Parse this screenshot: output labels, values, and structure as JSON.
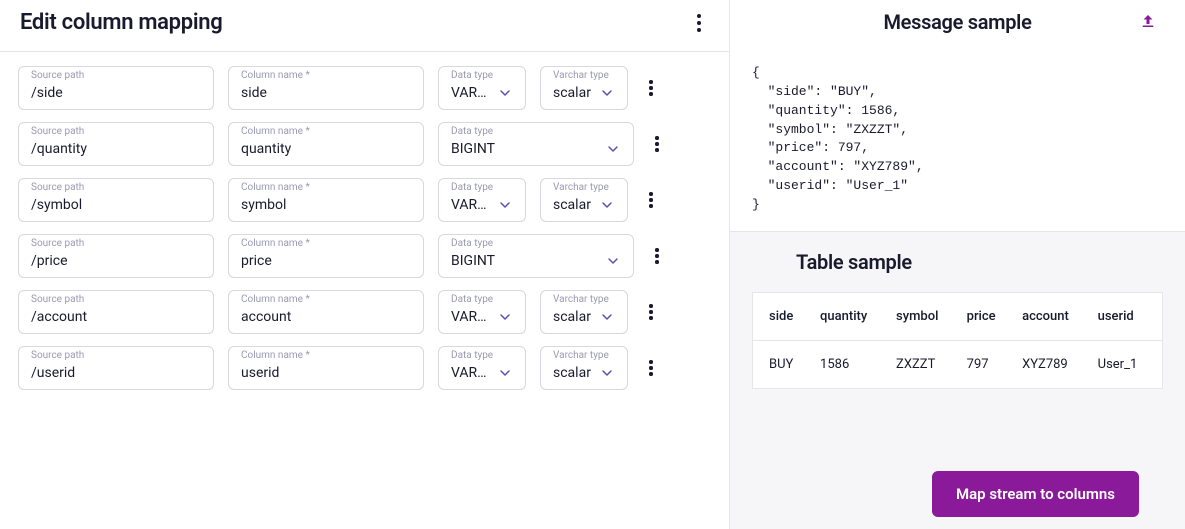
{
  "left": {
    "title": "Edit column mapping",
    "labels": {
      "source_path": "Source path",
      "column_name": "Column name *",
      "data_type": "Data type",
      "varchar_type": "Varchar type"
    },
    "rows": [
      {
        "source_path": "/side",
        "column_name": "side",
        "data_type": "VARC...",
        "data_type_wide": false,
        "varchar_type": "scalar"
      },
      {
        "source_path": "/quantity",
        "column_name": "quantity",
        "data_type": "BIGINT",
        "data_type_wide": true,
        "varchar_type": null
      },
      {
        "source_path": "/symbol",
        "column_name": "symbol",
        "data_type": "VARC...",
        "data_type_wide": false,
        "varchar_type": "scalar"
      },
      {
        "source_path": "/price",
        "column_name": "price",
        "data_type": "BIGINT",
        "data_type_wide": true,
        "varchar_type": null
      },
      {
        "source_path": "/account",
        "column_name": "account",
        "data_type": "VARC...",
        "data_type_wide": false,
        "varchar_type": "scalar"
      },
      {
        "source_path": "/userid",
        "column_name": "userid",
        "data_type": "VARC...",
        "data_type_wide": false,
        "varchar_type": "scalar"
      }
    ]
  },
  "right": {
    "message_sample_title": "Message sample",
    "json_lines": [
      "{",
      "  \"side\": \"BUY\",",
      "  \"quantity\": 1586,",
      "  \"symbol\": \"ZXZZT\",",
      "  \"price\": 797,",
      "  \"account\": \"XYZ789\",",
      "  \"userid\": \"User_1\"",
      "}"
    ],
    "table_sample_title": "Table sample",
    "table": {
      "headers": [
        "side",
        "quantity",
        "symbol",
        "price",
        "account",
        "userid"
      ],
      "row": [
        "BUY",
        "1586",
        "ZXZZT",
        "797",
        "XYZ789",
        "User_1"
      ]
    }
  },
  "cta_label": "Map stream to columns",
  "colors": {
    "accent": "#8b1a9b",
    "border": "#e5e5ea",
    "label": "#9a99b0"
  }
}
